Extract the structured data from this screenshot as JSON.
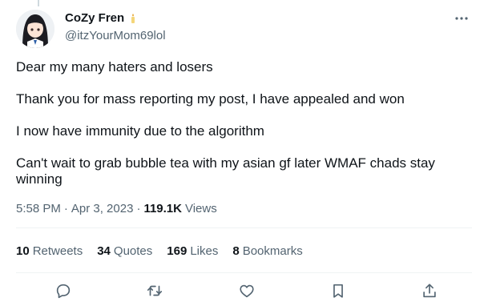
{
  "author": {
    "display_name": "CoZy Fren",
    "handle": "@itzYourMom69lol"
  },
  "tweet": {
    "paragraphs": [
      "Dear my many haters and losers",
      "Thank you for mass reporting my post, I have appealed and won",
      "I now have immunity due to the algorithm",
      "Can't wait to grab bubble tea with my asian gf later WMAF chads stay winning"
    ],
    "time": "5:58 PM",
    "separator": "·",
    "date": "Apr 3, 2023",
    "views_count": "119.1K",
    "views_label": "Views"
  },
  "stats": {
    "retweets": {
      "count": "10",
      "label": "Retweets"
    },
    "quotes": {
      "count": "34",
      "label": "Quotes"
    },
    "likes": {
      "count": "169",
      "label": "Likes"
    },
    "bookmarks": {
      "count": "8",
      "label": "Bookmarks"
    }
  },
  "icons": {
    "more": "more-horizontal-icon",
    "reply": "reply-icon",
    "retweet": "retweet-icon",
    "like": "heart-icon",
    "bookmark": "bookmark-icon",
    "share": "share-icon"
  },
  "colors": {
    "text": "#0f1419",
    "secondary": "#536471",
    "divider": "#eff3f4",
    "badge": "#f4d67a"
  }
}
